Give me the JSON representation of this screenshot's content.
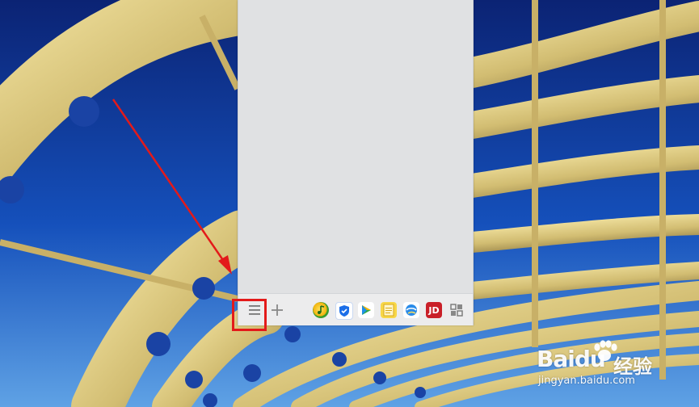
{
  "taskbar_panel": {
    "menu_icon_name": "hamburger-menu-icon",
    "add_icon_name": "plus-icon",
    "apps": [
      {
        "name": "music-app-icon"
      },
      {
        "name": "security-shield-icon"
      },
      {
        "name": "video-player-icon"
      },
      {
        "name": "notes-icon"
      },
      {
        "name": "browser-icon"
      },
      {
        "name": "jd-shopping-icon",
        "label": "JD"
      },
      {
        "name": "apps-grid-icon"
      }
    ]
  },
  "watermark": {
    "brand": "Baidu",
    "chinese": "经验",
    "url": "jingyan.baidu.com"
  },
  "colors": {
    "annotation_red": "#e31a1a",
    "sky_blue": "#0d2f8e",
    "panel_gray": "#e4e5e7"
  }
}
